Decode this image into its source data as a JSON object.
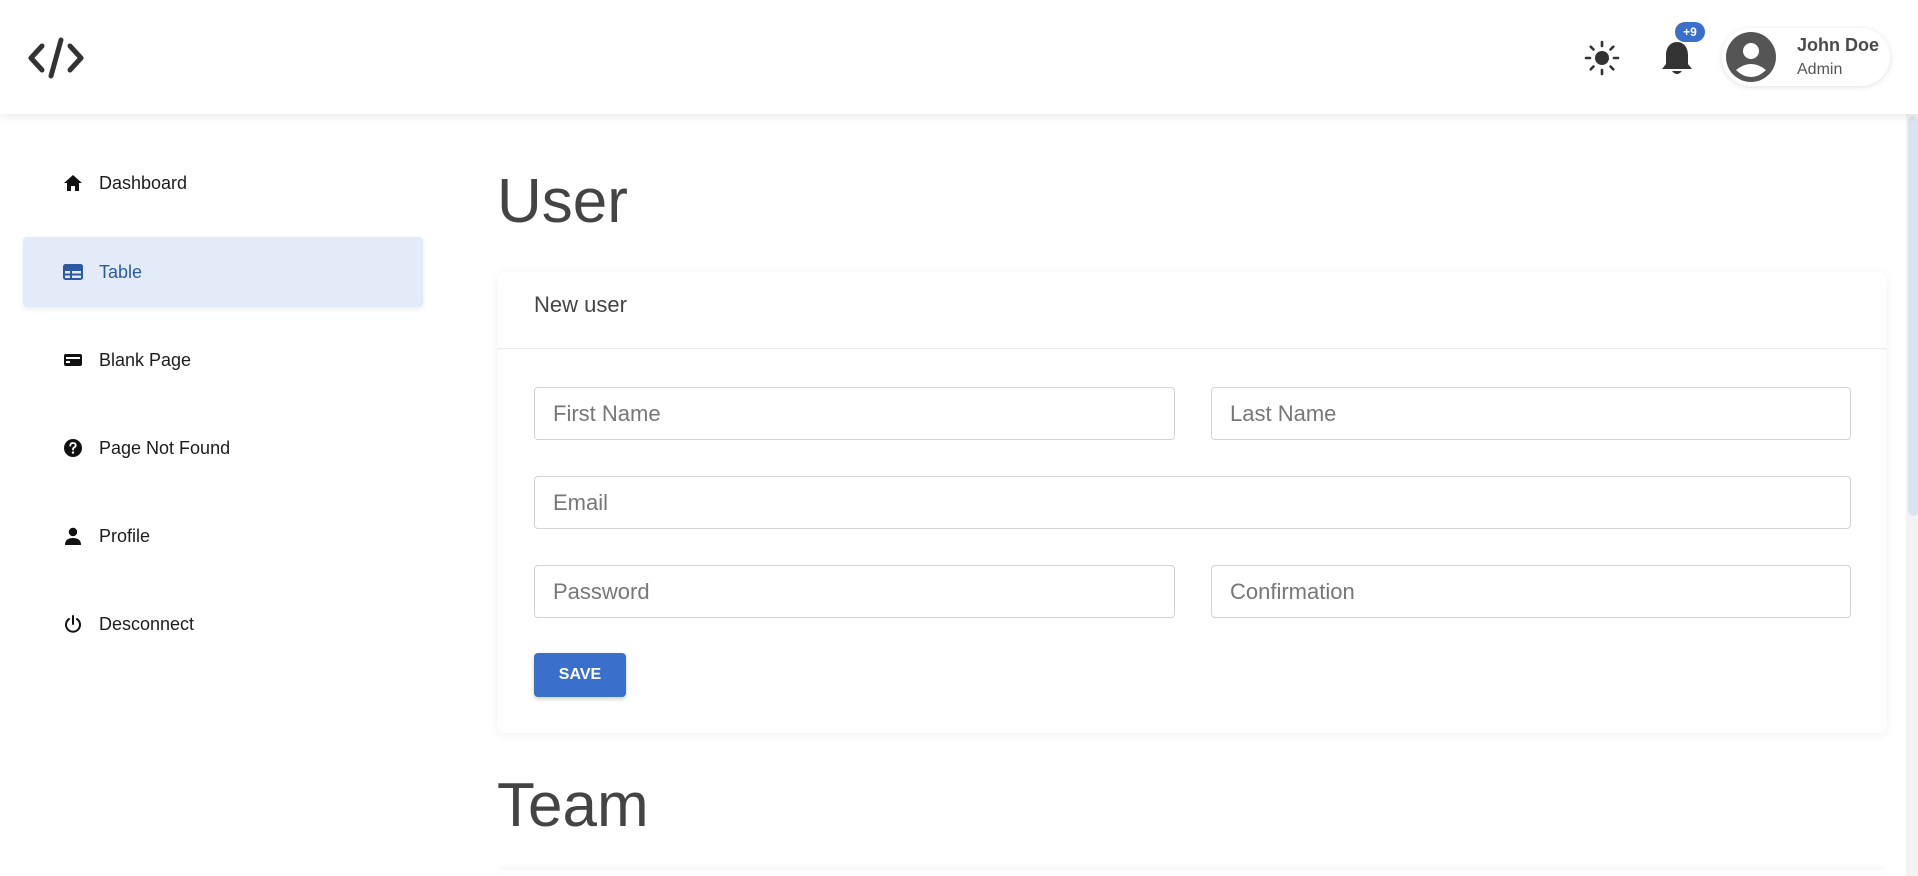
{
  "header": {
    "user": {
      "name": "John Doe",
      "role": "Admin"
    },
    "notifications": {
      "badge": "+9"
    },
    "logo_icon": "code-icon",
    "theme_icon": "sun-icon"
  },
  "sidebar": {
    "items": [
      {
        "label": "Dashboard",
        "icon": "home-icon",
        "active": false
      },
      {
        "label": "Table",
        "icon": "table-icon",
        "active": true
      },
      {
        "label": "Blank Page",
        "icon": "card-icon",
        "active": false
      },
      {
        "label": "Page Not Found",
        "icon": "help-circle-icon",
        "active": false
      },
      {
        "label": "Profile",
        "icon": "person-icon",
        "active": false
      },
      {
        "label": "Desconnect",
        "icon": "power-icon",
        "active": false
      }
    ]
  },
  "main": {
    "title": "User",
    "form": {
      "card_title": "New user",
      "first_name": {
        "placeholder": "First Name",
        "value": ""
      },
      "last_name": {
        "placeholder": "Last Name",
        "value": ""
      },
      "email": {
        "placeholder": "Email",
        "value": ""
      },
      "password": {
        "placeholder": "Password",
        "value": ""
      },
      "confirmation": {
        "placeholder": "Confirmation",
        "value": ""
      },
      "save_label": "SAVE"
    },
    "team_title": "Team"
  },
  "colors": {
    "accent": "#3b6fcc",
    "active_nav_bg": "#e4ebf8",
    "active_nav_text": "#2c5aa0",
    "heading": "#444444"
  }
}
